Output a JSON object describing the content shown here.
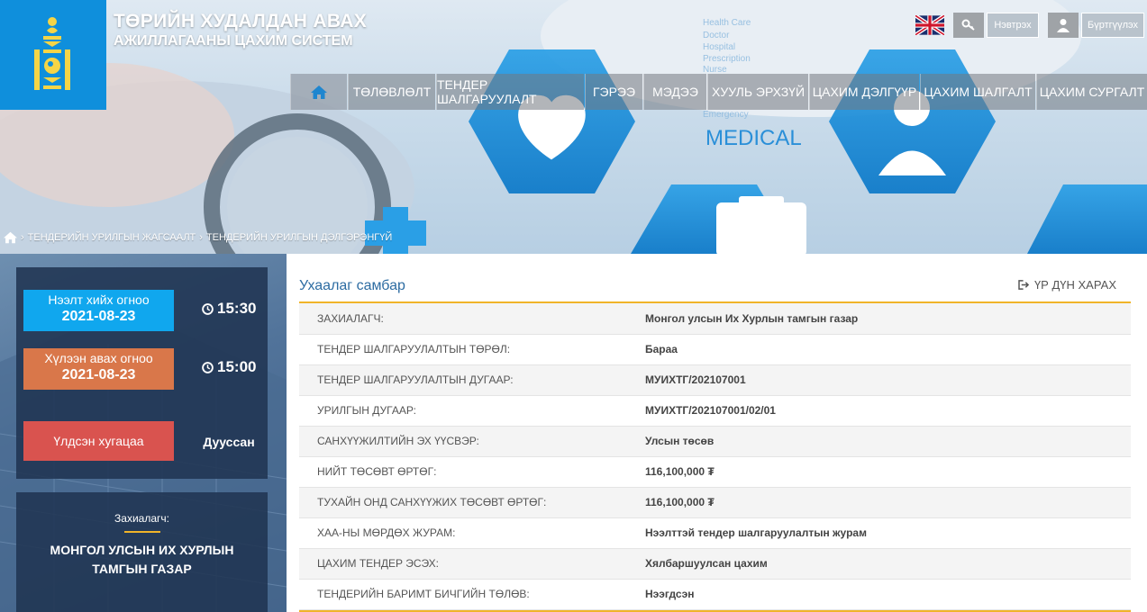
{
  "header": {
    "title_line1": "ТӨРИЙН ХУДАЛДАН АВАХ",
    "title_line2": "АЖИЛЛАГААНЫ ЦАХИМ СИСТЕМ",
    "logo_icon": "soyombo-emblem-icon",
    "language_icon": "uk-flag-icon",
    "login_icon": "key-icon",
    "login_label": "Нэвтрэх",
    "register_icon": "user-icon",
    "register_label": "Бүртгүүлэх"
  },
  "banner_text": {
    "medical": "MEDICAL",
    "words": [
      "Health Care",
      "Doctor",
      "Hospital",
      "Prescription",
      "Nurse",
      "Emergency"
    ]
  },
  "nav": {
    "home_icon": "home-icon",
    "items": [
      {
        "label": "ТӨЛӨВЛӨЛТ"
      },
      {
        "label": "ТЕНДЕР ШАЛГАРУУЛАЛТ"
      },
      {
        "label": "ГЭРЭЭ"
      },
      {
        "label": "МЭДЭЭ"
      },
      {
        "label": "ХУУЛЬ ЭРХЗҮЙ"
      },
      {
        "label": "ЦАХИМ ДЭЛГҮҮР"
      },
      {
        "label": "ЦАХИМ ШАЛГАЛТ"
      },
      {
        "label": "ЦАХИМ СУРГАЛТ"
      }
    ]
  },
  "breadcrumb": {
    "home_icon": "home-icon",
    "items": [
      "ТЕНДЕРИЙН УРИЛГЫН ЖАГСААЛТ",
      "ТЕНДЕРИЙН УРИЛГЫН ДЭЛГЭРЭНГҮЙ"
    ]
  },
  "timer": {
    "open_label": "Нээлт хийх огноо",
    "open_date": "2021-08-23",
    "open_time": "15:30",
    "receive_label": "Хүлээн авах огноо",
    "receive_date": "2021-08-23",
    "receive_time": "15:00",
    "remaining_label": "Үлдсэн хугацаа",
    "remaining_value": "Дууссан",
    "clock_icon": "clock-icon",
    "colors": {
      "open": "#10a7ee",
      "receive": "#d9774a",
      "remaining": "#d9534f"
    }
  },
  "customer": {
    "label": "Захиалагч:",
    "name": "МОНГОЛ УЛСЫН ИХ ХУРЛЫН ТАМГЫН ГАЗАР"
  },
  "panel": {
    "title": "Ухаалаг самбар",
    "result_icon": "sign-out-icon",
    "result_label": "ҮР ДҮН ХАРАХ",
    "accent_color": "#f0b429",
    "rows": [
      {
        "key": "ЗАХИАЛАГЧ:",
        "value": "Монгол улсын Их Хурлын тамгын газар"
      },
      {
        "key": "ТЕНДЕР ШАЛГАРУУЛАЛТЫН ТӨРӨЛ:",
        "value": "Бараа"
      },
      {
        "key": "ТЕНДЕР ШАЛГАРУУЛАЛТЫН ДУГААР:",
        "value": "МУИХТГ/202107001"
      },
      {
        "key": "УРИЛГЫН ДУГААР:",
        "value": "МУИХТГ/202107001/02/01"
      },
      {
        "key": "САНХҮҮЖИЛТИЙН ЭХ ҮҮСВЭР:",
        "value": "Улсын төсөв"
      },
      {
        "key": "НИЙТ ТӨСӨВТ ӨРТӨГ:",
        "value": "116,100,000 ₮"
      },
      {
        "key": "ТУХАЙН ОНД САНХҮҮЖИХ ТӨСӨВТ ӨРТӨГ:",
        "value": "116,100,000 ₮"
      },
      {
        "key": "ХАА-НЫ МӨРДӨХ ЖУРАМ:",
        "value": "Нээлттэй тендер шалгаруулалтын журам"
      },
      {
        "key": "ЦАХИМ ТЕНДЕР ЭСЭХ:",
        "value": "Хялбаршуулсан цахим"
      },
      {
        "key": "ТЕНДЕРИЙН БАРИМТ БИЧГИЙН ТӨЛӨВ:",
        "value": "Нээгдсэн"
      }
    ]
  }
}
